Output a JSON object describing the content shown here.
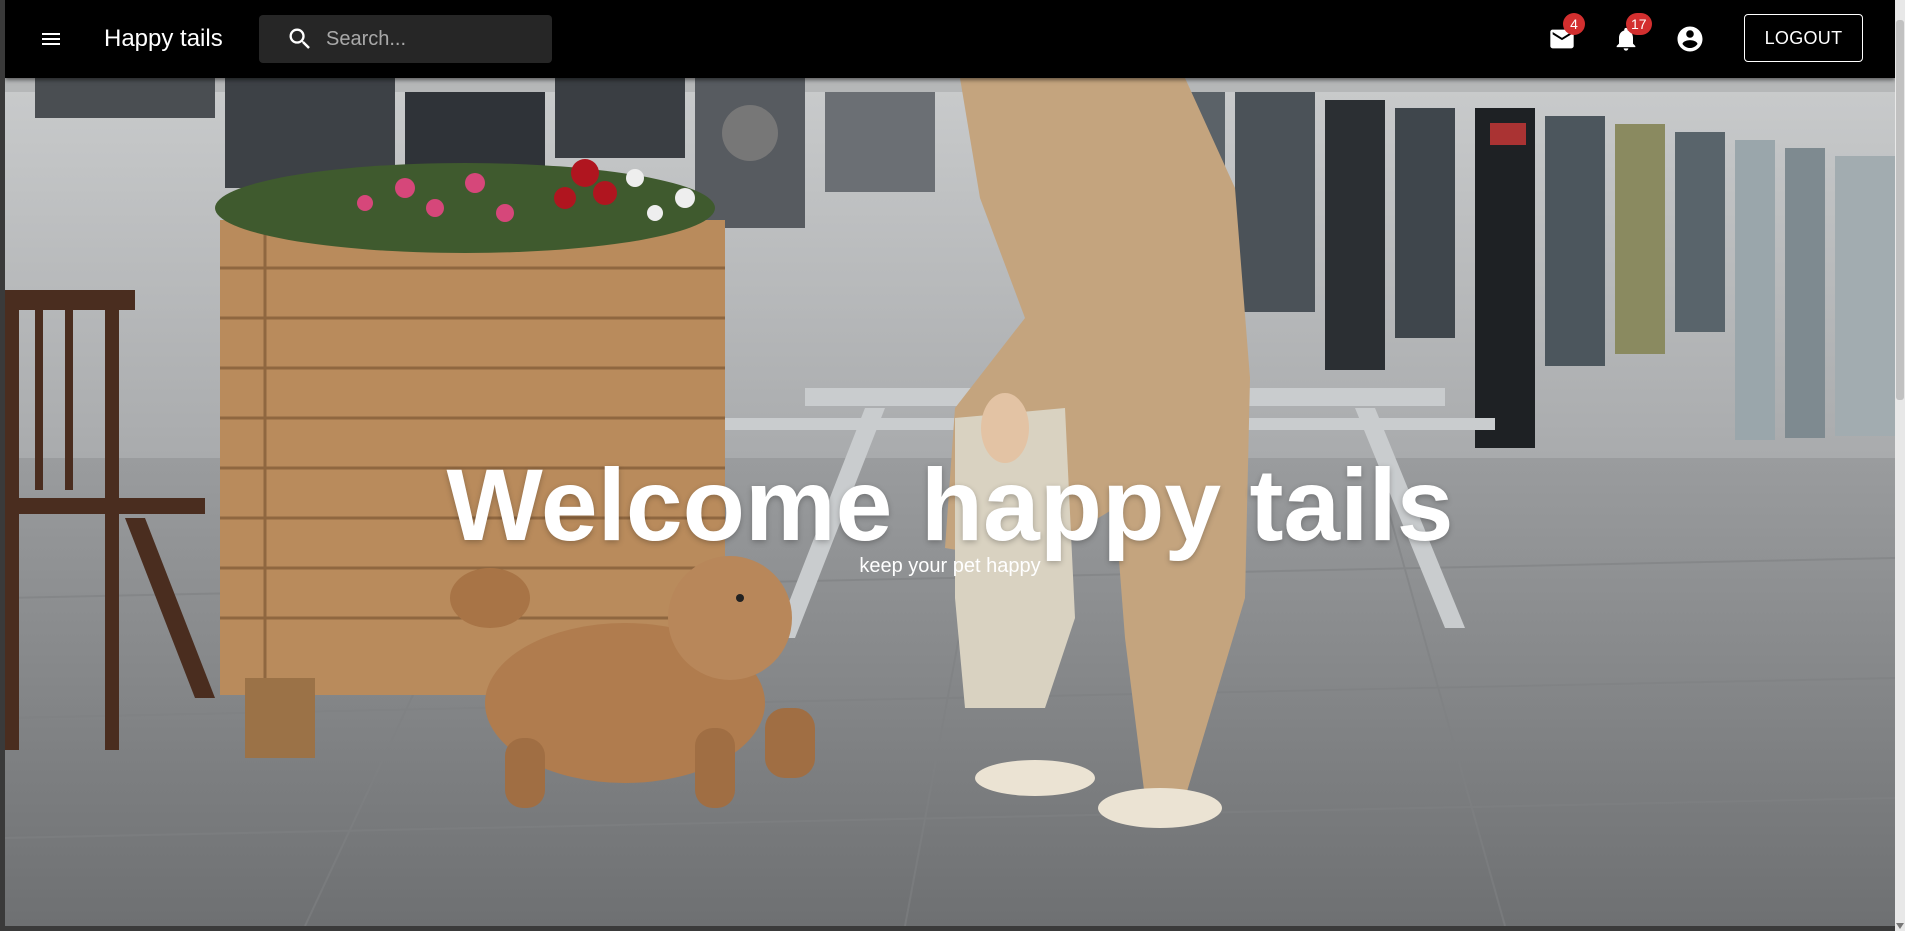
{
  "appbar": {
    "brand": "Happy tails",
    "search_placeholder": "Search...",
    "mail_count": "4",
    "notification_count": "17",
    "logout_label": "LOGOUT"
  },
  "hero": {
    "title": "Welcome happy tails",
    "subtitle": "keep your pet happy"
  },
  "icons": {
    "menu": "menu-icon",
    "search": "search-icon",
    "mail": "mail-icon",
    "notifications": "bell-icon",
    "account": "account-circle-icon"
  },
  "colors": {
    "appbar_bg": "#000000",
    "badge": "#d32f2f",
    "text": "#ffffff"
  }
}
